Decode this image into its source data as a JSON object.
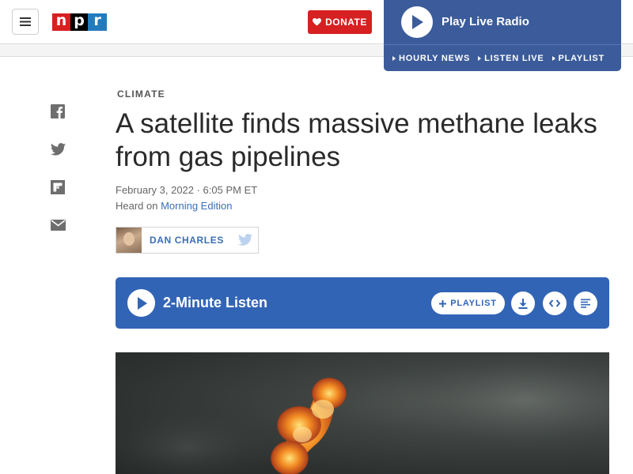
{
  "header": {
    "logo_letters": [
      "n",
      "p",
      "r"
    ],
    "donate_label": "DONATE",
    "radio": {
      "title": "Play Live Radio",
      "links": [
        "HOURLY NEWS",
        "LISTEN LIVE",
        "PLAYLIST"
      ]
    }
  },
  "share_icons": [
    "facebook-icon",
    "twitter-icon",
    "flipboard-icon",
    "email-icon"
  ],
  "article": {
    "slug": "CLIMATE",
    "headline": "A satellite finds massive methane leaks from gas pipelines",
    "dateline": "February 3, 2022 · 6:05 PM ET",
    "heard_prefix": "Heard on ",
    "heard_program": "Morning Edition",
    "author": "DAN CHARLES"
  },
  "player": {
    "title": "2-Minute Listen",
    "playlist_label": "PLAYLIST",
    "actions": [
      "download-icon",
      "embed-icon",
      "transcript-icon"
    ]
  },
  "colors": {
    "npr_red": "#d62021",
    "npr_blue": "#237bbd",
    "radio_panel": "#3b5b9a",
    "player_blue": "#3264b6",
    "link_blue": "#3b6fb5"
  }
}
